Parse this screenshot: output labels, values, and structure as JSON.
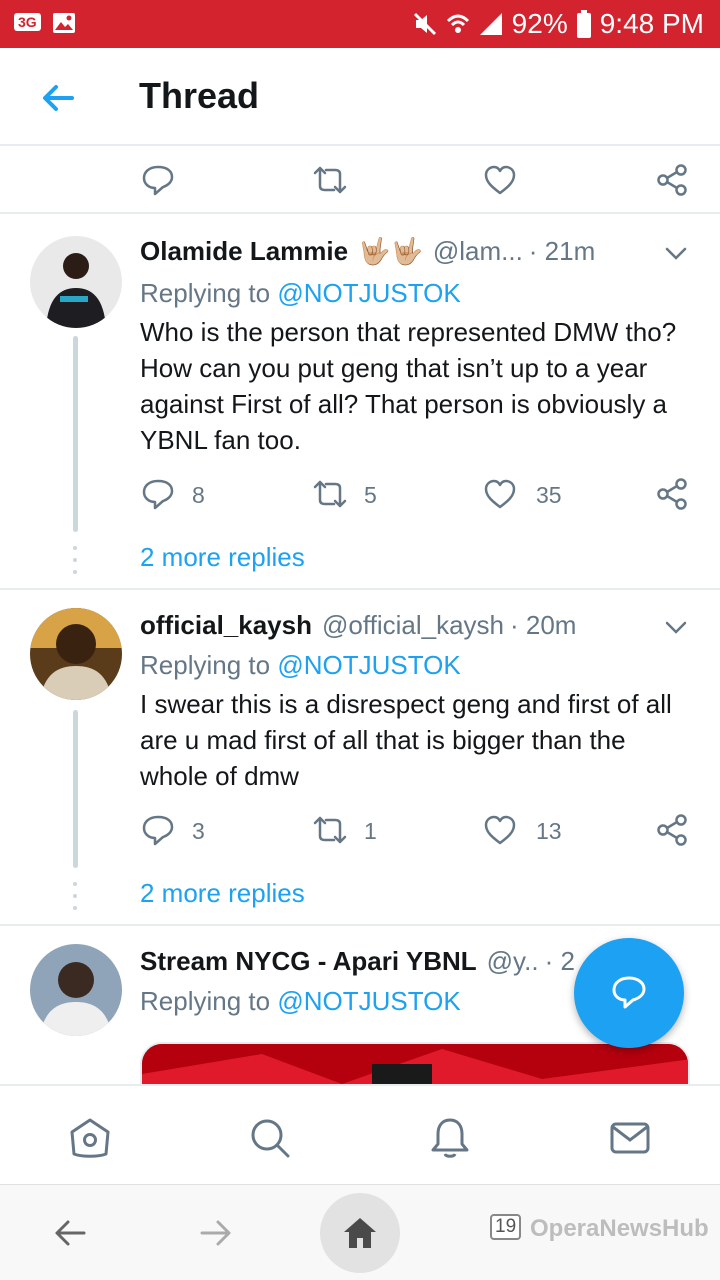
{
  "status_bar": {
    "network": "3G",
    "battery": "92%",
    "time": "9:48 PM"
  },
  "header": {
    "title": "Thread"
  },
  "tweets": [
    {
      "name": "Olamide Lammie",
      "name_emoji": "🤟🏼🤟🏼",
      "handle": "@lam...",
      "time": "· 21m",
      "replying_label": "Replying to",
      "replying_to": "@NOTJUSTOK",
      "body": "Who is the person that represented DMW tho? How can you put geng that isn’t up to a year against First of all? That person is obviously a YBNL fan too.",
      "replies": "8",
      "retweets": "5",
      "likes": "35",
      "more_replies": "2 more replies"
    },
    {
      "name": "official_kaysh",
      "handle": "@official_kaysh",
      "time": "· 20m",
      "replying_label": "Replying to",
      "replying_to": "@NOTJUSTOK",
      "body": "I swear this is a disrespect geng and first of all are u mad first of all that is bigger than the whole of dmw",
      "replies": "3",
      "retweets": "1",
      "likes": "13",
      "more_replies": "2 more replies"
    },
    {
      "name": "Stream NYCG - Apari YBNL",
      "handle": "@y..",
      "time": "· 2",
      "replying_label": "Replying to",
      "replying_to": "@NOTJUSTOK"
    }
  ],
  "browser_bar": {
    "tab_count": "19",
    "watermark": "OperaNewsHub"
  },
  "colors": {
    "status_bar": "#d2232e",
    "accent": "#1da1f2",
    "muted": "#657786"
  }
}
